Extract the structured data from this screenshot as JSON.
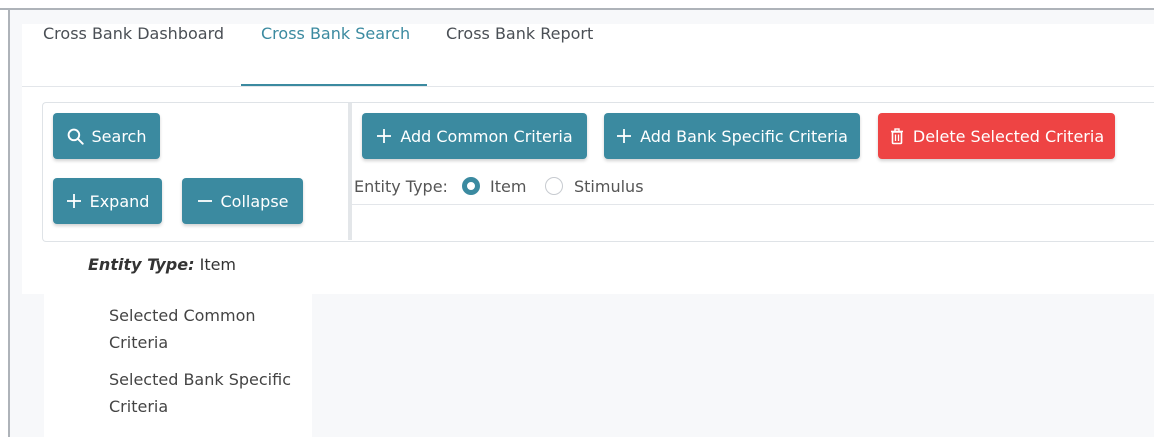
{
  "tabs": [
    {
      "label": "Cross Bank Dashboard"
    },
    {
      "label": "Cross Bank Search"
    },
    {
      "label": "Cross Bank Report"
    }
  ],
  "active_tab": "Cross Bank Search",
  "left_toolbar": {
    "search_label": "Search",
    "expand_label": "Expand",
    "collapse_label": "Collapse"
  },
  "criteria_toolbar": {
    "add_common_label": "Add Common Criteria",
    "add_bank_specific_label": "Add Bank Specific Criteria",
    "delete_selected_label": "Delete Selected Criteria"
  },
  "entity_type": {
    "label": "Entity Type:",
    "options": [
      {
        "label": "Item",
        "selected": true
      },
      {
        "label": "Stimulus",
        "selected": false
      }
    ]
  },
  "summary": {
    "entity_type_key": "Entity Type:",
    "entity_type_value": "Item",
    "tree_items": [
      {
        "label": "Selected Common Criteria"
      },
      {
        "label": "Selected Bank Specific Criteria"
      }
    ]
  },
  "colors": {
    "primary": "#3b8aa0",
    "danger": "#ee4444",
    "text": "#4a4f55"
  },
  "icons": {
    "search": "search-icon",
    "expand": "plus-icon",
    "collapse": "minus-icon",
    "add_common": "plus-icon",
    "add_bank_specific": "plus-icon",
    "delete": "trash-icon"
  }
}
